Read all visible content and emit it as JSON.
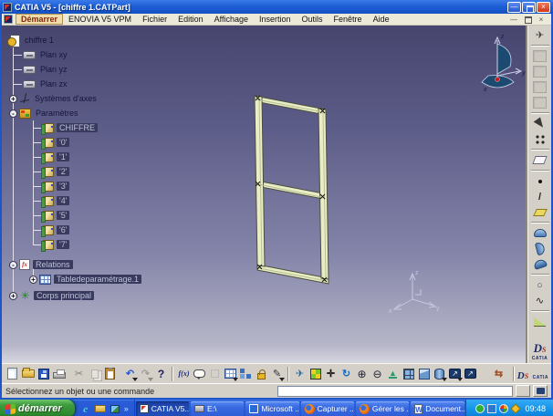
{
  "colors": {
    "titlebar_blue": "#1e5fd6",
    "menu_highlight": "#f0ddac",
    "viewport_gradient_top": "#45456e",
    "viewport_gradient_bottom": "#d8d8e2",
    "model_fill": "#e9edc6",
    "tree_selection_box": "#3a3a5e",
    "taskbar_blue": "#2a5cd8",
    "start_green": "#3d9a3d",
    "close_red": "#d43418",
    "compass_fill": "#1d4a70",
    "compass_dot_red": "#cc1818"
  },
  "window": {
    "title": "CATIA V5 - [chiffre 1.CATPart]",
    "controls": {
      "minimize": "—",
      "close": "×"
    },
    "mdi_controls": {
      "minimize": "—",
      "close": "×"
    }
  },
  "menu_bar": {
    "items": [
      {
        "label": "Démarrer",
        "highlighted": true
      },
      {
        "label": "ENOVIA V5 VPM"
      },
      {
        "label": "Fichier"
      },
      {
        "label": "Edition"
      },
      {
        "label": "Affichage"
      },
      {
        "label": "Insertion"
      },
      {
        "label": "Outils"
      },
      {
        "label": "Fenêtre"
      },
      {
        "label": "Aide"
      }
    ]
  },
  "tree": {
    "icon_glyphs": {
      "relations": "fx",
      "body": "✳"
    },
    "items": [
      {
        "label": "chiffre 1",
        "icon": "part-icon",
        "level": 0
      },
      {
        "label": "Plan xy",
        "icon": "plane-icon",
        "level": 1
      },
      {
        "label": "Plan yz",
        "icon": "plane-icon",
        "level": 1
      },
      {
        "label": "Plan zx",
        "icon": "plane-icon",
        "level": 1
      },
      {
        "label": "Systèmes d'axes",
        "icon": "axes-icon",
        "level": 1,
        "expander": "+"
      },
      {
        "label": "Paramètres",
        "icon": "parameters-icon",
        "level": 1,
        "expander": "-"
      },
      {
        "label": "CHIFFRE",
        "icon": "parameter-icon",
        "level": 2,
        "boxed": true
      },
      {
        "label": "'0'",
        "icon": "parameter-icon",
        "level": 2,
        "boxed": true
      },
      {
        "label": "'1'",
        "icon": "parameter-icon",
        "level": 2,
        "boxed": true
      },
      {
        "label": "'2'",
        "icon": "parameter-icon",
        "level": 2,
        "boxed": true
      },
      {
        "label": "'3'",
        "icon": "parameter-icon",
        "level": 2,
        "boxed": true
      },
      {
        "label": "'4'",
        "icon": "parameter-icon",
        "level": 2,
        "boxed": true
      },
      {
        "label": "'5'",
        "icon": "parameter-icon",
        "level": 2,
        "boxed": true
      },
      {
        "label": "'6'",
        "icon": "parameter-icon",
        "level": 2,
        "boxed": true
      },
      {
        "label": "'7'",
        "icon": "parameter-icon",
        "level": 2,
        "boxed": true
      },
      {
        "label": "Relations",
        "icon": "relations-icon",
        "level": 1,
        "expander": "-",
        "boxed": true
      },
      {
        "label": "Tabledeparamétrage.1",
        "icon": "design-table-icon",
        "level": 2,
        "expander": "+",
        "boxed": true
      },
      {
        "label": "Corps principal",
        "icon": "body-icon",
        "level": 1,
        "expander": "+",
        "boxed": true
      }
    ]
  },
  "viewport": {
    "compass": {
      "x": "x",
      "y": "y",
      "z": "z"
    },
    "triad": {
      "x": "x",
      "y": "y",
      "z": "z"
    }
  },
  "toolbar_right": {
    "icons": [
      {
        "name": "fly-mode-icon",
        "glyph": "✈"
      },
      {
        "name": "disabled-slot-1",
        "glyph": ""
      },
      {
        "name": "disabled-slot-2",
        "glyph": ""
      },
      {
        "name": "disabled-slot-3",
        "glyph": ""
      },
      {
        "name": "disabled-slot-4",
        "glyph": ""
      },
      {
        "name": "select-arrow-icon",
        "glyph": ""
      },
      {
        "name": "sketch-points-icon",
        "glyph": ""
      },
      {
        "name": "sketcher-icon",
        "glyph": ""
      },
      {
        "name": "point-icon",
        "glyph": ""
      },
      {
        "name": "line-icon",
        "glyph": "/"
      },
      {
        "name": "plane-icon",
        "glyph": ""
      },
      {
        "name": "extrude-surface-icon",
        "glyph": ""
      },
      {
        "name": "revolve-surface-icon",
        "glyph": ""
      },
      {
        "name": "sweep-surface-icon",
        "glyph": ""
      },
      {
        "name": "circle-icon",
        "glyph": "○"
      },
      {
        "name": "spline-icon",
        "glyph": "∿"
      },
      {
        "name": "fill-surface-icon",
        "glyph": ""
      }
    ]
  },
  "toolbar_bottom": {
    "icons": [
      {
        "name": "new-document-icon",
        "glyph": ""
      },
      {
        "name": "open-icon",
        "glyph": ""
      },
      {
        "name": "save-icon",
        "glyph": ""
      },
      {
        "name": "print-icon",
        "glyph": ""
      },
      {
        "name": "cut-icon",
        "glyph": "✂",
        "disabled": true
      },
      {
        "name": "copy-icon",
        "glyph": "",
        "disabled": true
      },
      {
        "name": "paste-icon",
        "glyph": ""
      },
      {
        "name": "undo-icon",
        "glyph": "↶"
      },
      {
        "name": "redo-icon",
        "glyph": "↷",
        "disabled": true
      },
      {
        "name": "help-icon",
        "glyph": "?"
      },
      {
        "name": "formula-icon",
        "glyph": "f(x)"
      },
      {
        "name": "comment-icon",
        "glyph": ""
      },
      {
        "name": "check-icon",
        "glyph": "",
        "disabled": true
      },
      {
        "name": "design-table-icon",
        "glyph": ""
      },
      {
        "name": "catalog-icon",
        "glyph": ""
      },
      {
        "name": "lock-icon",
        "glyph": ""
      },
      {
        "name": "knowledge-icon",
        "glyph": "✎"
      },
      {
        "name": "fly-icon",
        "glyph": "✈"
      },
      {
        "name": "fit-all-icon",
        "glyph": ""
      },
      {
        "name": "pan-icon",
        "glyph": "✛"
      },
      {
        "name": "rotate-icon",
        "glyph": "↻"
      },
      {
        "name": "zoom-in-icon",
        "glyph": "⊕"
      },
      {
        "name": "zoom-out-icon",
        "glyph": "⊖"
      },
      {
        "name": "normal-view-icon",
        "glyph": "▲"
      },
      {
        "name": "multi-view-icon",
        "glyph": ""
      },
      {
        "name": "iso-view-icon",
        "glyph": ""
      },
      {
        "name": "render-style-icon",
        "glyph": ""
      },
      {
        "name": "quick-view-1-icon",
        "glyph": "↗"
      },
      {
        "name": "quick-view-2-icon",
        "glyph": "↗"
      },
      {
        "name": "swap-space-icon",
        "glyph": "⇆"
      }
    ]
  },
  "status_bar": {
    "message": "Sélectionnez un objet ou une commande"
  },
  "taskbar": {
    "start": "démarrer",
    "quick_launch_more": "»",
    "windows": [
      {
        "label": "CATIA V5...",
        "active": true
      },
      {
        "label": "E:\\"
      },
      {
        "label": "Microsoft ..."
      },
      {
        "label": "Capturer ..."
      },
      {
        "label": "Gérer les ..."
      },
      {
        "label": "Document..."
      }
    ],
    "clock": "09:48"
  },
  "brand": {
    "name": "CATIA"
  }
}
